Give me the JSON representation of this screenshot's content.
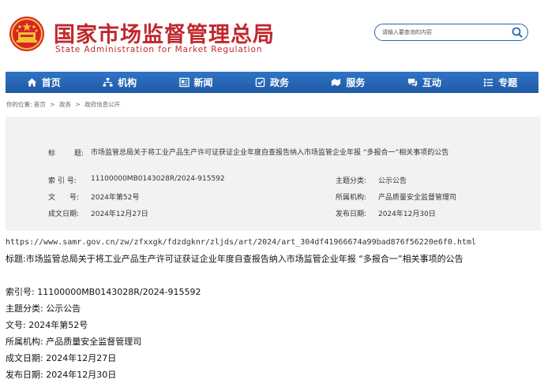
{
  "header": {
    "logo_cn": "国家市场监督管理总局",
    "logo_en": "State Administration for Market Regulation",
    "emblem_icon": "national-emblem-icon",
    "search_placeholder": "请输入要查询的内容",
    "colors": {
      "brand_red": "#c1272d",
      "nav_blue": "#2463b0"
    }
  },
  "nav": {
    "items": [
      {
        "label": "首页",
        "icon": "home-icon"
      },
      {
        "label": "机构",
        "icon": "org-icon"
      },
      {
        "label": "新闻",
        "icon": "news-icon"
      },
      {
        "label": "政务",
        "icon": "affairs-icon"
      },
      {
        "label": "服务",
        "icon": "service-icon"
      },
      {
        "label": "互动",
        "icon": "interaction-icon"
      },
      {
        "label": "专题",
        "icon": "topic-icon"
      }
    ]
  },
  "breadcrumb": {
    "prefix": "你的位置:",
    "items": [
      "首页",
      "政务",
      "政府信息公开"
    ],
    "separator": ">"
  },
  "info": {
    "title_label_a": "标",
    "title_label_b": "题:",
    "title_value": "市场监管总局关于将工业产品生产许可证获证企业年度自查报告纳入市场监管企业年报 “多报合一”相关事项的公告",
    "index_label": "索 引 号:",
    "index_value": "11100000MB0143028R/2024-915592",
    "category_label": "主题分类:",
    "category_value": "公示公告",
    "docno_label": "文　　号:",
    "docno_value": "2024年第52号",
    "dept_label": "所属机构:",
    "dept_value": "产品质量安全监督管理司",
    "created_label": "成文日期:",
    "created_value": "2024年12月27日",
    "published_label": "发布日期:",
    "published_value": "2024年12月30日"
  },
  "plain": {
    "url": "https://www.samr.gov.cn/zw/zfxxgk/fdzdgknr/zljds/art/2024/art_304df41966674a99bad876f56220e6f0.html",
    "title": "标题:市场监管总局关于将工业产品生产许可证获证企业年度自查报告纳入市场监管企业年报 “多报合一”相关事项的公告",
    "index": "索引号: 11100000MB0143028R/2024-915592",
    "category": "主题分类: 公示公告",
    "docno": "文号: 2024年第52号",
    "dept": "所属机构: 产品质量安全监督管理司",
    "created": "成文日期: 2024年12月27日",
    "published": "发布日期: 2024年12月30日"
  }
}
